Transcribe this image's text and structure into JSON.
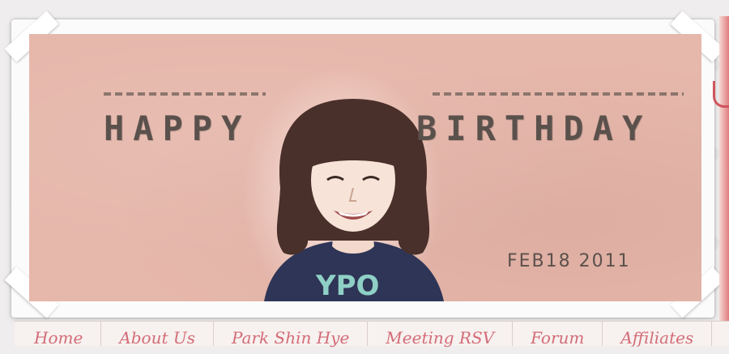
{
  "banner": {
    "title_left": "HAPPY",
    "title_right": "BIRTHDAY",
    "date": "FEB18 2011",
    "shirt_text": "YPO"
  },
  "nav": {
    "items": [
      {
        "label": "Home"
      },
      {
        "label": "About Us"
      },
      {
        "label": "Park Shin Hye"
      },
      {
        "label": "Meeting RSV"
      },
      {
        "label": "Forum"
      },
      {
        "label": "Affiliates"
      }
    ]
  },
  "colors": {
    "banner_bg": "#e6b7ab",
    "title_text": "#5b514c",
    "nav_text": "#d36c78",
    "ribbon": "#e07b7e"
  }
}
